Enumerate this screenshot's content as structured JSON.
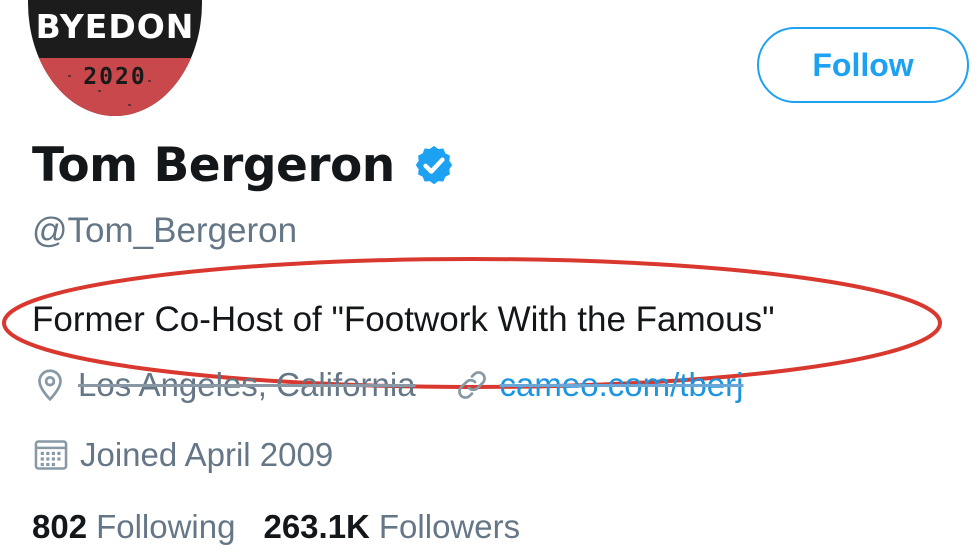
{
  "avatar": {
    "title": "BYEDON",
    "year": "2020"
  },
  "follow_button": {
    "label": "Follow"
  },
  "profile": {
    "name": "Tom Bergeron",
    "handle": "@Tom_Bergeron",
    "bio": "Former Co-Host of \"Footwork With the Famous\"",
    "location": "Los Angeles, California",
    "website": "cameo.com/tberj",
    "joined": "Joined April 2009"
  },
  "stats": {
    "following_count": "802",
    "following_label": "Following",
    "followers_count": "263.1K",
    "followers_label": "Followers"
  },
  "icons": {
    "verified": "verified-badge-icon",
    "location": "location-pin-icon",
    "link": "link-icon",
    "calendar": "calendar-icon"
  },
  "colors": {
    "accent": "#1da1f2",
    "link": "#1b95e0",
    "secondary_text": "#657786",
    "primary_text": "#14171a",
    "annotation": "#d9382f"
  }
}
